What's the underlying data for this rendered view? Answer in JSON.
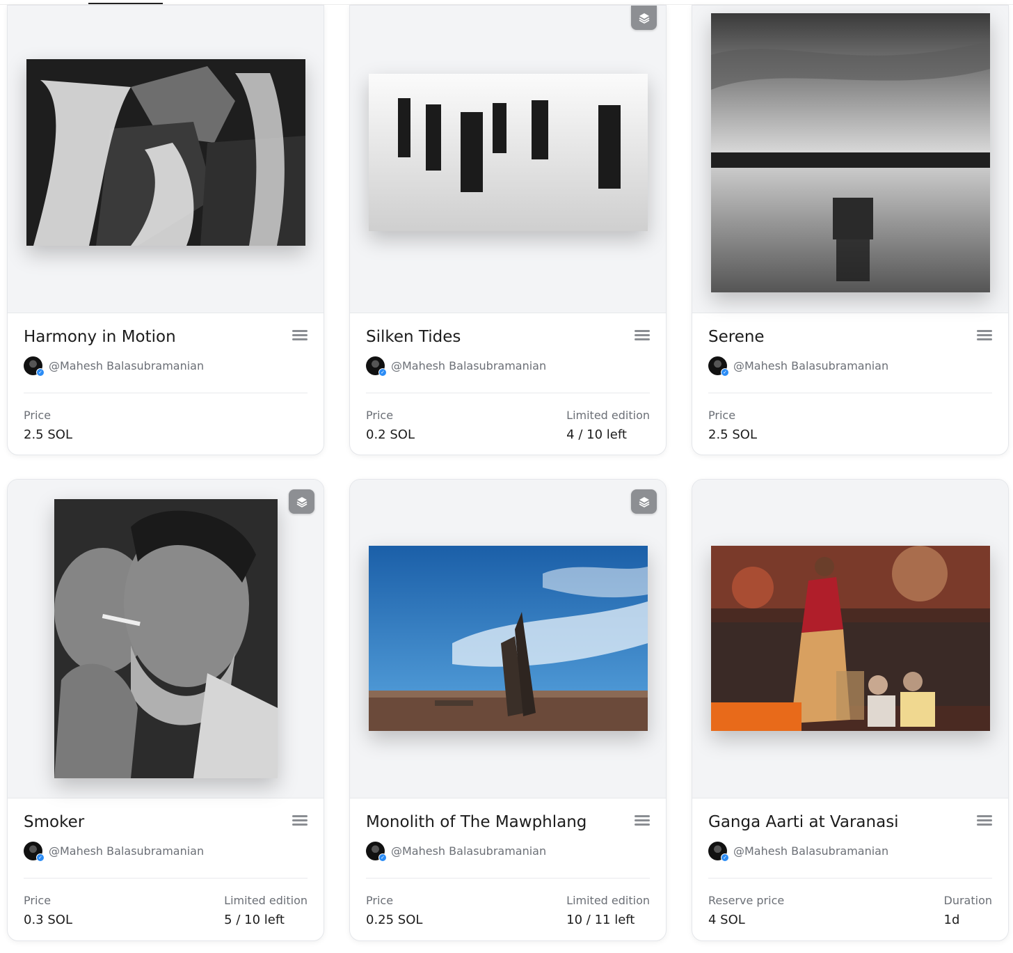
{
  "cards": [
    {
      "title": "Harmony in Motion",
      "creator": "@Mahesh Balasubramanian",
      "price_label": "Price",
      "price": "2.5 SOL",
      "art_icon": "waterfall-image"
    },
    {
      "title": "Silken Tides",
      "creator": "@Mahesh Balasubramanian",
      "price_label": "Price",
      "price": "0.2 SOL",
      "edition_label": "Limited edition",
      "edition": "4 / 10 left",
      "art_icon": "pier-posts-image"
    },
    {
      "title": "Serene",
      "creator": "@Mahesh Balasubramanian",
      "price_label": "Price",
      "price": "2.5 SOL",
      "art_icon": "lake-image"
    },
    {
      "title": "Smoker",
      "creator": "@Mahesh Balasubramanian",
      "price_label": "Price",
      "price": "0.3 SOL",
      "edition_label": "Limited edition",
      "edition": "5 / 10 left",
      "art_icon": "portrait-image"
    },
    {
      "title": "Monolith of The Mawphlang",
      "creator": "@Mahesh Balasubramanian",
      "price_label": "Price",
      "price": "0.25 SOL",
      "edition_label": "Limited edition",
      "edition": "10 / 11 left",
      "art_icon": "monolith-image"
    },
    {
      "title": "Ganga Aarti at Varanasi",
      "creator": "@Mahesh Balasubramanian",
      "price_label": "Reserve price",
      "price": "4 SOL",
      "edition_label": "Duration",
      "edition": "1d",
      "art_icon": "aarti-image"
    }
  ],
  "icons": {
    "edition_badge": "layers-icon",
    "menu": "menu-icon",
    "verified": "verified-check-icon"
  },
  "colors": {
    "badge_bg": "#8d8f93",
    "verified": "#2b8cf5",
    "media_bg": "#f3f4f6"
  }
}
